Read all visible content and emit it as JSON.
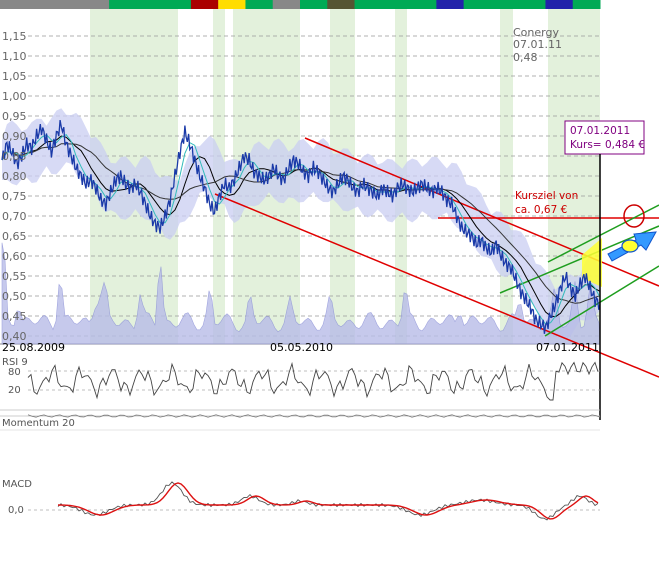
{
  "chart_data": [
    {
      "type": "line",
      "instrument": {
        "name": "Conergy",
        "date": "07.01.11",
        "value": "0,48"
      },
      "price_tooltip": {
        "date": "07.01.2011",
        "text": "Kurs= 0,484 €"
      },
      "target_annotation": {
        "line1": "Kursziel von",
        "line2": "ca. 0,67 €",
        "value": 0.67
      },
      "y_ticks": [
        "1,15",
        "1,10",
        "1,05",
        "1,00",
        "0,95",
        "0,90",
        "0,85",
        "0,80",
        "0,75",
        "0,70",
        "0,65",
        "0,60",
        "0,55",
        "0,50",
        "0,45",
        "0,40"
      ],
      "x_labels": [
        {
          "text": "25.08.2009",
          "pos": "left"
        },
        {
          "text": "05.05.2010",
          "pos": "middle"
        },
        {
          "text": "07.01.2011",
          "pos": "right"
        }
      ],
      "ylim": [
        0.38,
        1.17
      ],
      "series": [
        {
          "values": [
            0.84,
            0.88,
            0.86,
            0.83,
            0.85,
            0.88,
            0.87,
            0.9,
            0.92,
            0.89,
            0.86,
            0.9,
            0.93,
            0.88,
            0.85,
            0.82,
            0.8,
            0.78,
            0.79,
            0.77,
            0.74,
            0.73,
            0.76,
            0.79,
            0.8,
            0.78,
            0.77,
            0.78,
            0.76,
            0.73,
            0.7,
            0.68,
            0.67,
            0.7,
            0.74,
            0.8,
            0.86,
            0.91,
            0.88,
            0.84,
            0.8,
            0.77,
            0.73,
            0.71,
            0.75,
            0.78,
            0.77,
            0.79,
            0.82,
            0.85,
            0.84,
            0.81,
            0.8,
            0.79,
            0.8,
            0.82,
            0.8,
            0.79,
            0.82,
            0.84,
            0.83,
            0.81,
            0.8,
            0.82,
            0.81,
            0.79,
            0.77,
            0.76,
            0.78,
            0.8,
            0.79,
            0.77,
            0.76,
            0.78,
            0.77,
            0.76,
            0.75,
            0.77,
            0.76,
            0.75,
            0.77,
            0.78,
            0.77,
            0.76,
            0.77,
            0.78,
            0.77,
            0.76,
            0.77,
            0.76,
            0.74,
            0.73,
            0.7,
            0.67,
            0.66,
            0.65,
            0.63,
            0.64,
            0.62,
            0.61,
            0.63,
            0.6,
            0.58,
            0.57,
            0.54,
            0.51,
            0.49,
            0.47,
            0.44,
            0.43,
            0.42,
            0.45,
            0.48,
            0.52,
            0.55,
            0.52,
            0.5,
            0.53,
            0.55,
            0.52,
            0.49,
            0.48
          ]
        }
      ],
      "indicators": [
        {
          "label": "RSI 9",
          "ticks": [
            "80",
            "20"
          ]
        },
        {
          "label": "Momentum 20"
        },
        {
          "label": "MACD",
          "ticks": [
            "0,0"
          ]
        }
      ]
    }
  ]
}
